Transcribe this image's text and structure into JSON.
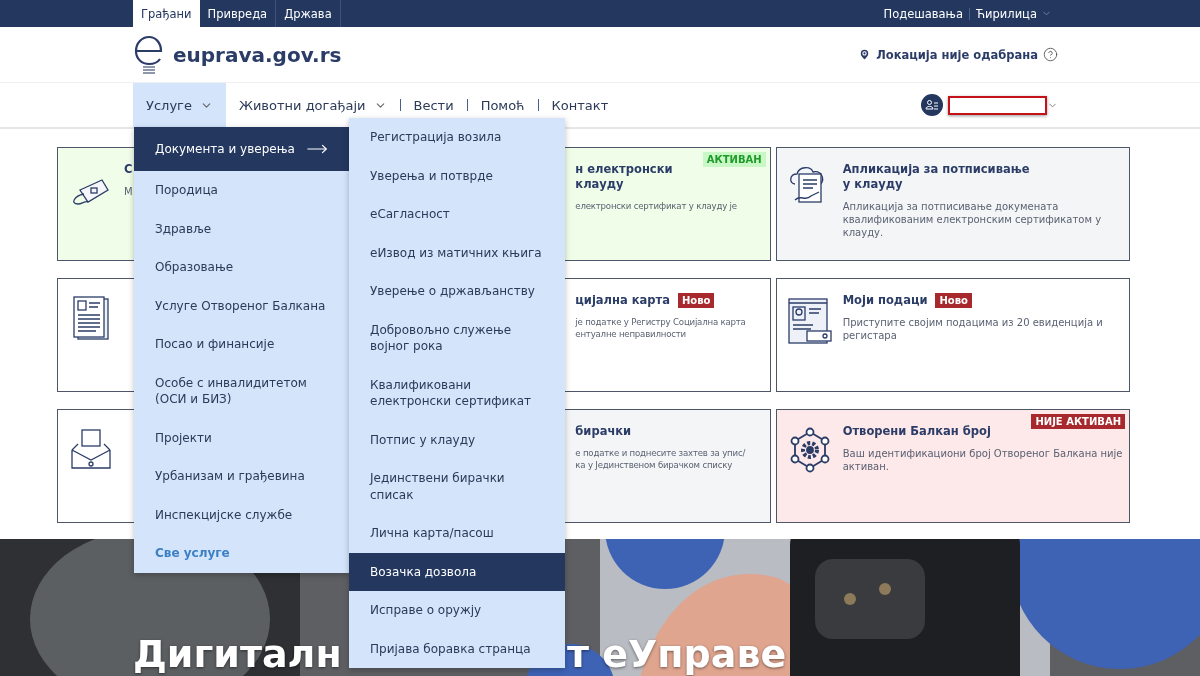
{
  "top_bar": {
    "tabs": [
      {
        "label": "Грађани",
        "selected": true
      },
      {
        "label": "Привреда",
        "selected": false
      },
      {
        "label": "Држава",
        "selected": false
      }
    ],
    "settings": "Подешавања",
    "language": "Ћирилица"
  },
  "header": {
    "logo_text": "euprava.gov.rs",
    "location": "Локација није одабрана"
  },
  "nav": {
    "items": [
      {
        "label": "Услуге",
        "selected": true,
        "dropdown": true
      },
      {
        "label": "Животни догађаји",
        "selected": false,
        "dropdown": true
      },
      {
        "label": "Вести",
        "selected": false,
        "dropdown": false
      },
      {
        "label": "Помоћ",
        "selected": false,
        "dropdown": false
      },
      {
        "label": "Контакт",
        "selected": false,
        "dropdown": false
      }
    ]
  },
  "cards": [
    {
      "color": "#effde9",
      "kind": "wallet",
      "covered": false,
      "title": "С",
      "description": "М"
    },
    {
      "color": "#effde9",
      "covered": true,
      "title": "н електронски\nклауду",
      "description": "електронски сертификат у клауду је",
      "badge": {
        "label": "АКТИВАН",
        "kind": "active"
      }
    },
    {
      "color": "#f4f5f7",
      "kind": "cloud-sign",
      "covered": false,
      "title": "Апликација за потписивање\nу клауду",
      "description": "Апликација за потписивање докумената квалификованим електронским сертификатом у клауду."
    },
    {
      "color": "#ffffff",
      "kind": "document"
    },
    {
      "color": "#ffffff",
      "covered": true,
      "title": "цијална карта",
      "description": "је податке у Регистру Социјална карта\nентуалне неправилности",
      "badge": {
        "label": "Ново",
        "kind": "new"
      }
    },
    {
      "color": "#ffffff",
      "kind": "profile",
      "covered": false,
      "title": "Моји подаци",
      "description": "Приступите својим подацима из 20 евиденција и регистара",
      "badge": {
        "label": "Ново",
        "kind": "new"
      }
    },
    {
      "color": "#ffffff",
      "kind": "mail"
    },
    {
      "color": "#f4f5f7",
      "covered": true,
      "title": "бирачки",
      "description": "е податке и поднесите захтев за упис/\nка у Јединственом бирачком списку"
    },
    {
      "color": "#fde8ea",
      "kind": "network",
      "covered": false,
      "title": "Отворени Балкан број",
      "description": "Ваш идентификациони број Отвореног Балкана није активан.",
      "badge": {
        "label": "НИЈЕ АКТИВАН",
        "kind": "inactive"
      }
    }
  ],
  "categories": [
    {
      "label": "Документа и уверења",
      "selected": true
    },
    {
      "label": "Породица",
      "selected": false
    },
    {
      "label": "Здравље",
      "selected": false
    },
    {
      "label": "Образовање",
      "selected": false
    },
    {
      "label": "Услуге Отвореног Балкана",
      "selected": false
    },
    {
      "label": "Посао и финансије",
      "selected": false
    },
    {
      "label": "Особе с инвалидитетом\n(ОСИ и БИЗ)",
      "selected": false
    },
    {
      "label": "Пројекти",
      "selected": false
    },
    {
      "label": "Урбанизам и грађевина",
      "selected": false
    },
    {
      "label": "Инспекцијске службе",
      "selected": false
    }
  ],
  "all_services": "Све услуге",
  "submenu": [
    {
      "label": "Регистрација возила",
      "selected": false
    },
    {
      "label": "Уверења и потврде",
      "selected": false
    },
    {
      "label": "еСагласност",
      "selected": false
    },
    {
      "label": "еИзвод из матичних књига",
      "selected": false
    },
    {
      "label": "Уверење о држављанству",
      "selected": false
    },
    {
      "label": "Добровољно служење\nвојног рока",
      "selected": false
    },
    {
      "label": "Квалификовани\nелектронски сертификат",
      "selected": false
    },
    {
      "label": "Потпис у клауду",
      "selected": false
    },
    {
      "label": "Јединствени бирачки\nсписак",
      "selected": false
    },
    {
      "label": "Лична карта/пасош",
      "selected": false
    },
    {
      "label": "Возачка дозвола",
      "selected": true
    },
    {
      "label": "Исправе о оружју",
      "selected": false
    },
    {
      "label": "Пријава боравка странца",
      "selected": false
    }
  ],
  "hero": {
    "title_start": "Дигиталн",
    "title_end": "т еУправе"
  }
}
